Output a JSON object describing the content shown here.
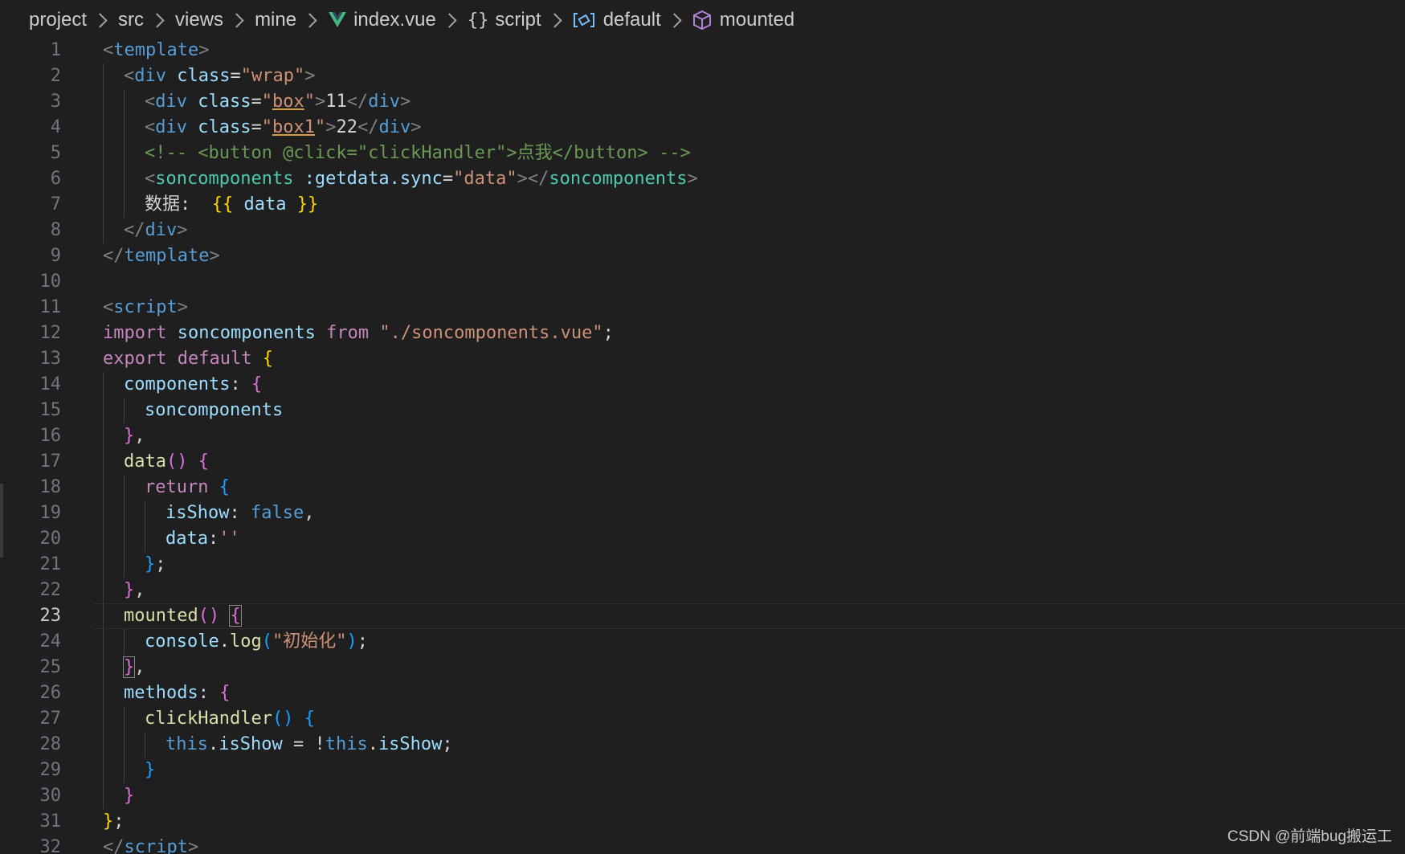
{
  "breadcrumb": {
    "items": [
      "project",
      "src",
      "views",
      "mine",
      "index.vue",
      "script",
      "default",
      "mounted"
    ],
    "braces": "{}"
  },
  "editor": {
    "current_line": 23,
    "lines": [
      {
        "n": 1,
        "indent": 0,
        "tokens": [
          [
            "t-punct",
            "<"
          ],
          [
            "t-tag",
            "template"
          ],
          [
            "t-punct",
            ">"
          ]
        ]
      },
      {
        "n": 2,
        "indent": 1,
        "tokens": [
          [
            "t-punct",
            "<"
          ],
          [
            "t-tag",
            "div"
          ],
          [
            "t-text",
            " "
          ],
          [
            "t-attr",
            "class"
          ],
          [
            "t-text",
            "="
          ],
          [
            "t-str",
            "\"wrap\""
          ],
          [
            "t-punct",
            ">"
          ]
        ]
      },
      {
        "n": 3,
        "indent": 2,
        "tokens": [
          [
            "t-punct",
            "<"
          ],
          [
            "t-tag",
            "div"
          ],
          [
            "t-text",
            " "
          ],
          [
            "t-attr",
            "class"
          ],
          [
            "t-text",
            "="
          ],
          [
            "t-str",
            "\""
          ],
          [
            "t-str u-err",
            "box"
          ],
          [
            "t-str",
            "\""
          ],
          [
            "t-punct",
            ">"
          ],
          [
            "t-text",
            "11"
          ],
          [
            "t-punct",
            "</"
          ],
          [
            "t-tag",
            "div"
          ],
          [
            "t-punct",
            ">"
          ]
        ]
      },
      {
        "n": 4,
        "indent": 2,
        "tokens": [
          [
            "t-punct",
            "<"
          ],
          [
            "t-tag",
            "div"
          ],
          [
            "t-text",
            " "
          ],
          [
            "t-attr",
            "class"
          ],
          [
            "t-text",
            "="
          ],
          [
            "t-str",
            "\""
          ],
          [
            "t-str u-err",
            "box1"
          ],
          [
            "t-str",
            "\""
          ],
          [
            "t-punct",
            ">"
          ],
          [
            "t-text",
            "22"
          ],
          [
            "t-punct",
            "</"
          ],
          [
            "t-tag",
            "div"
          ],
          [
            "t-punct",
            ">"
          ]
        ]
      },
      {
        "n": 5,
        "indent": 2,
        "tokens": [
          [
            "t-comment",
            "<!-- <button @click=\"clickHandler\">点我</button> -->"
          ]
        ]
      },
      {
        "n": 6,
        "indent": 2,
        "tokens": [
          [
            "t-punct",
            "<"
          ],
          [
            "t-comp",
            "soncomponents"
          ],
          [
            "t-text",
            " "
          ],
          [
            "t-attr",
            ":getdata.sync"
          ],
          [
            "t-text",
            "="
          ],
          [
            "t-str",
            "\"data\""
          ],
          [
            "t-punct",
            "></"
          ],
          [
            "t-comp",
            "soncomponents"
          ],
          [
            "t-punct",
            ">"
          ]
        ]
      },
      {
        "n": 7,
        "indent": 2,
        "tokens": [
          [
            "t-text",
            "数据:  "
          ],
          [
            "t-brace1",
            "{{"
          ],
          [
            "t-attr",
            " data "
          ],
          [
            "t-brace1",
            "}}"
          ]
        ]
      },
      {
        "n": 8,
        "indent": 1,
        "tokens": [
          [
            "t-punct",
            "</"
          ],
          [
            "t-tag",
            "div"
          ],
          [
            "t-punct",
            ">"
          ]
        ]
      },
      {
        "n": 9,
        "indent": 0,
        "tokens": [
          [
            "t-punct",
            "</"
          ],
          [
            "t-tag",
            "template"
          ],
          [
            "t-punct",
            ">"
          ]
        ]
      },
      {
        "n": 10,
        "indent": 0,
        "tokens": []
      },
      {
        "n": 11,
        "indent": 0,
        "tokens": [
          [
            "t-punct",
            "<"
          ],
          [
            "t-tag",
            "script"
          ],
          [
            "t-punct",
            ">"
          ]
        ]
      },
      {
        "n": 12,
        "indent": 0,
        "tokens": [
          [
            "t-keyword",
            "import"
          ],
          [
            "t-text",
            " "
          ],
          [
            "t-attr",
            "soncomponents"
          ],
          [
            "t-text",
            " "
          ],
          [
            "t-keyword",
            "from"
          ],
          [
            "t-text",
            " "
          ],
          [
            "t-str",
            "\"./soncomponents.vue\""
          ],
          [
            "t-text",
            ";"
          ]
        ]
      },
      {
        "n": 13,
        "indent": 0,
        "tokens": [
          [
            "t-keyword",
            "export"
          ],
          [
            "t-text",
            " "
          ],
          [
            "t-keyword",
            "default"
          ],
          [
            "t-text",
            " "
          ],
          [
            "t-brace1",
            "{"
          ]
        ]
      },
      {
        "n": 14,
        "indent": 1,
        "tokens": [
          [
            "t-attr",
            "components"
          ],
          [
            "t-text",
            ": "
          ],
          [
            "t-brace2",
            "{"
          ]
        ]
      },
      {
        "n": 15,
        "indent": 2,
        "tokens": [
          [
            "t-attr",
            "soncomponents"
          ]
        ]
      },
      {
        "n": 16,
        "indent": 1,
        "tokens": [
          [
            "t-brace2",
            "}"
          ],
          [
            "t-text",
            ","
          ]
        ]
      },
      {
        "n": 17,
        "indent": 1,
        "tokens": [
          [
            "t-fn",
            "data"
          ],
          [
            "t-brace2",
            "()"
          ],
          [
            "t-text",
            " "
          ],
          [
            "t-brace2",
            "{"
          ]
        ]
      },
      {
        "n": 18,
        "indent": 2,
        "tokens": [
          [
            "t-keyword",
            "return"
          ],
          [
            "t-text",
            " "
          ],
          [
            "t-brace3",
            "{"
          ]
        ]
      },
      {
        "n": 19,
        "indent": 3,
        "tokens": [
          [
            "t-attr",
            "isShow"
          ],
          [
            "t-text",
            ": "
          ],
          [
            "t-bool",
            "false"
          ],
          [
            "t-text",
            ","
          ]
        ]
      },
      {
        "n": 20,
        "indent": 3,
        "tokens": [
          [
            "t-attr",
            "data"
          ],
          [
            "t-text",
            ":"
          ],
          [
            "t-str",
            "''"
          ]
        ]
      },
      {
        "n": 21,
        "indent": 2,
        "tokens": [
          [
            "t-brace3",
            "}"
          ],
          [
            "t-text",
            ";"
          ]
        ]
      },
      {
        "n": 22,
        "indent": 1,
        "tokens": [
          [
            "t-brace2",
            "}"
          ],
          [
            "t-text",
            ","
          ]
        ]
      },
      {
        "n": 23,
        "indent": 1,
        "tokens": [
          [
            "t-fn",
            "mounted"
          ],
          [
            "t-brace2",
            "()"
          ],
          [
            "t-text",
            " "
          ],
          [
            "t-brace2 b-match",
            "{"
          ]
        ]
      },
      {
        "n": 24,
        "indent": 2,
        "tokens": [
          [
            "t-attr",
            "console"
          ],
          [
            "t-text",
            "."
          ],
          [
            "t-fn",
            "log"
          ],
          [
            "t-brace3",
            "("
          ],
          [
            "t-str",
            "\"初始化\""
          ],
          [
            "t-brace3",
            ")"
          ],
          [
            "t-text",
            ";"
          ]
        ]
      },
      {
        "n": 25,
        "indent": 1,
        "tokens": [
          [
            "t-brace2 b-match",
            "}"
          ],
          [
            "t-text",
            ","
          ]
        ]
      },
      {
        "n": 26,
        "indent": 1,
        "tokens": [
          [
            "t-attr",
            "methods"
          ],
          [
            "t-text",
            ": "
          ],
          [
            "t-brace2",
            "{"
          ]
        ]
      },
      {
        "n": 27,
        "indent": 2,
        "tokens": [
          [
            "t-fn",
            "clickHandler"
          ],
          [
            "t-brace3",
            "()"
          ],
          [
            "t-text",
            " "
          ],
          [
            "t-brace3",
            "{"
          ]
        ]
      },
      {
        "n": 28,
        "indent": 3,
        "tokens": [
          [
            "t-bool",
            "this"
          ],
          [
            "t-text",
            "."
          ],
          [
            "t-attr",
            "isShow"
          ],
          [
            "t-text",
            " = !"
          ],
          [
            "t-bool",
            "this"
          ],
          [
            "t-text",
            "."
          ],
          [
            "t-attr",
            "isShow"
          ],
          [
            "t-text",
            ";"
          ]
        ]
      },
      {
        "n": 29,
        "indent": 2,
        "tokens": [
          [
            "t-brace3",
            "}"
          ]
        ]
      },
      {
        "n": 30,
        "indent": 1,
        "tokens": [
          [
            "t-brace2",
            "}"
          ]
        ]
      },
      {
        "n": 31,
        "indent": 0,
        "tokens": [
          [
            "t-brace1",
            "}"
          ],
          [
            "t-text",
            ";"
          ]
        ]
      },
      {
        "n": 32,
        "indent": 0,
        "tokens": [
          [
            "t-punct",
            "</"
          ],
          [
            "t-tag",
            "script"
          ],
          [
            "t-punct",
            ">"
          ]
        ]
      }
    ]
  },
  "watermark": "CSDN @前端bug搬运工",
  "colors": {
    "background": "#1f1f1f",
    "vue_icon": "#42b883",
    "module_icon": "#75beff",
    "cube_icon": "#b180d7"
  },
  "icons": [
    "chevron-right-icon",
    "vue-file-icon",
    "braces-icon",
    "module-icon",
    "cube-icon"
  ]
}
